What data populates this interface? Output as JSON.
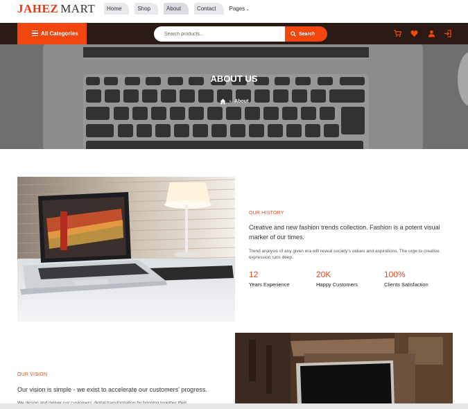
{
  "brand": {
    "part1": "JAHEZ",
    "part2": "MART"
  },
  "nav": [
    {
      "label": "Home"
    },
    {
      "label": "Shop"
    },
    {
      "label": "About"
    },
    {
      "label": "Contact"
    },
    {
      "label": "Pages"
    }
  ],
  "toolbar": {
    "all_categories": "All Categories",
    "search_placeholder": "Search products...",
    "search_button": "Search",
    "icons": [
      "cart-icon",
      "heart-icon",
      "user-icon",
      "login-icon"
    ]
  },
  "hero": {
    "title": "ABOUT US",
    "breadcrumb_current": "About"
  },
  "history": {
    "label": "OUR HISTORY",
    "lead": "Creative and new fashion trends collection. Fashion is a potent visual marker of our times.",
    "body": "Trend analysis of any given era will reveal society's values and aspirations. The urge to creative expression runs deep.",
    "stats": [
      {
        "number": "12",
        "label": "Years Experience"
      },
      {
        "number": "20K",
        "label": "Happy Customers"
      },
      {
        "number": "100%",
        "label": "Clients Satisfaction"
      }
    ]
  },
  "vision": {
    "label": "OUR VISION",
    "lead": "Our vision is simple - we exist to accelerate our customers' progress.",
    "body": "We design and deliver our customers' digital transformation by bringing together their"
  },
  "colors": {
    "accent": "#f2460f",
    "dark": "#2b1a13"
  }
}
